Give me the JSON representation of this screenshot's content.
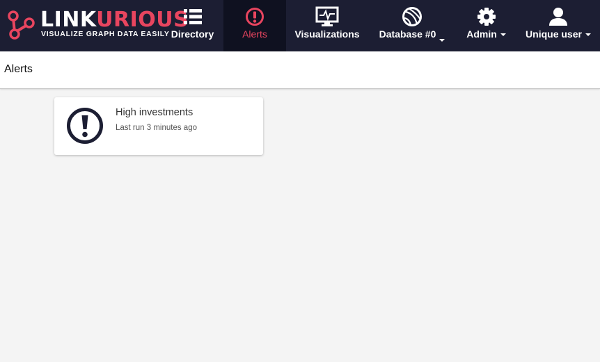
{
  "brand": {
    "name_part1": "LINK",
    "name_part2": "URIOUS",
    "tagline": "VISUALIZE GRAPH DATA EASILY",
    "colors": {
      "accent": "#e8455f",
      "navbar": "#1c1e33",
      "navbar_active": "#0f1120"
    }
  },
  "nav": {
    "directory": {
      "label": "Directory",
      "icon": "list-icon"
    },
    "alerts": {
      "label": "Alerts",
      "icon": "alert-icon",
      "active": true
    },
    "visualizations": {
      "label": "Visualizations",
      "icon": "monitor-icon"
    },
    "database": {
      "label": "Database #0",
      "icon": "globe-icon",
      "dropdown": true
    },
    "admin": {
      "label": "Admin",
      "icon": "gear-icon",
      "dropdown": true
    },
    "user": {
      "label": "Unique user",
      "icon": "user-icon",
      "dropdown": true
    }
  },
  "page": {
    "title": "Alerts"
  },
  "alerts": [
    {
      "title": "High investments",
      "last_run": "Last run 3 minutes ago",
      "icon": "exclamation-circle-icon"
    }
  ]
}
